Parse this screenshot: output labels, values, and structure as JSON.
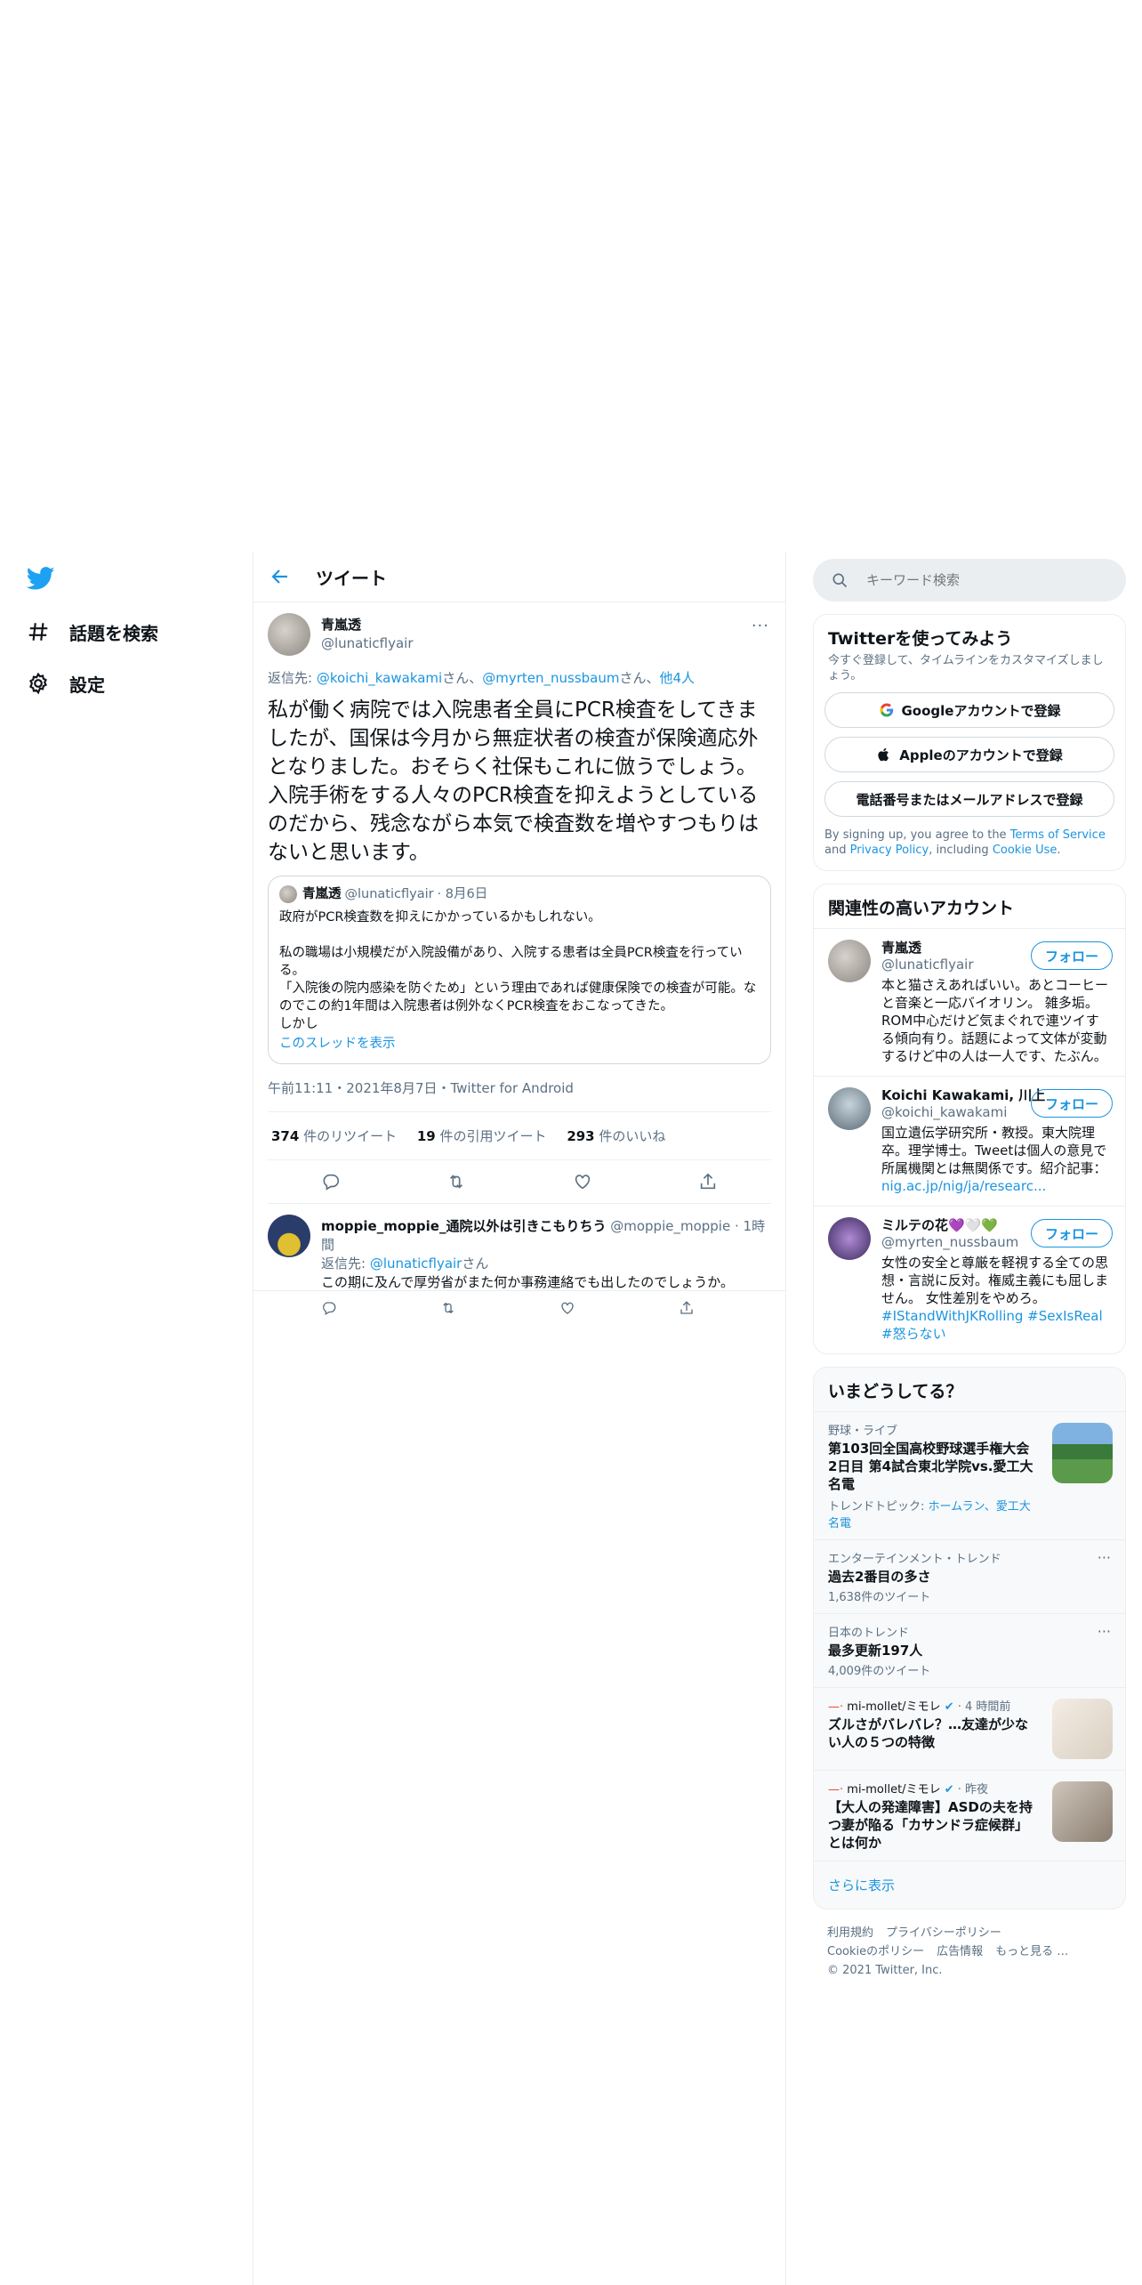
{
  "nav": {
    "items": [
      {
        "label": "話題を検索",
        "icon": "hashtag-icon"
      },
      {
        "label": "設定",
        "icon": "gear-icon"
      }
    ]
  },
  "header": {
    "title": "ツイート"
  },
  "tweet": {
    "name": "青嵐透",
    "handle": "@lunaticflyair",
    "reply_prefix": "返信先: ",
    "reply_1": "@koichi_kawakami",
    "reply_sep1": "さん、",
    "reply_2": "@myrten_nussbaum",
    "reply_sep2": "さん、",
    "reply_others": "他4人",
    "text": "私が働く病院では入院患者全員にPCR検査をしてきましたが、国保は今月から無症状者の検査が保険適応外となりました。おそらく社保もこれに倣うでしょう。\n入院手術をする人々のPCR検査を抑えようとしているのだから、残念ながら本気で検査数を増やすつもりはないと思います。",
    "quote": {
      "name": "青嵐透",
      "handle": "@lunaticflyair",
      "date": "· 8月6日",
      "text": "政府がPCR検査数を抑えにかかっているかもしれない。\n\n私の職場は小規模だが入院設備があり、入院する患者は全員PCR検査を行っている。\n「入院後の院内感染を防ぐため」という理由であれば健康保険での検査が可能。なのでこの約1年間は入院患者は例外なくPCR検査をおこなってきた。\nしかし",
      "show_thread": "このスレッドを表示"
    },
    "meta": "午前11:11・2021年8月7日・Twitter for Android",
    "stats": {
      "retweets": "374",
      "retweets_label": " 件のリツイート",
      "quotes": "19",
      "quotes_label": " 件の引用ツイート",
      "likes": "293",
      "likes_label": " 件のいいね"
    }
  },
  "reply": {
    "name": "moppie_moppie_通院以外は引きこもりちう",
    "handle": "@moppie_moppie",
    "time": "· 1時間",
    "reply_prefix": "返信先: ",
    "reply_to": "@lunaticflyair",
    "reply_suffix": "さん",
    "text": "この期に及んで厚労省がまた何か事務連絡でも出したのでしょうか。"
  },
  "search": {
    "placeholder": "キーワード検索"
  },
  "signup": {
    "title": "Twitterを使ってみよう",
    "sub": "今すぐ登録して、タイムラインをカスタマイズしましょう。",
    "google": "Googleアカウントで登録",
    "apple": "Appleのアカウントで登録",
    "phone": "電話番号またはメールアドレスで登録",
    "legal_1": "By signing up, you agree to the ",
    "terms": "Terms of Service",
    "legal_2": " and ",
    "privacy": "Privacy Policy",
    "legal_3": ", including ",
    "cookie": "Cookie Use",
    "legal_4": "."
  },
  "related": {
    "title": "関連性の高いアカウント",
    "follow": "フォロー",
    "accounts": [
      {
        "name": "青嵐透",
        "handle": "@lunaticflyair",
        "bio": "本と猫さえあればいい。あとコーヒーと音楽と一応バイオリン。 雑多垢。ROM中心だけど気まぐれで連ツイする傾向有り。話題によって文体が変動するけど中の人は一人です、たぶん。"
      },
      {
        "name": "Koichi Kawakami, 川上",
        "handle": "@koichi_kawakami",
        "bio": "国立遺伝学研究所・教授。東大院理卒。理学博士。Tweetは個人の意見で所属機関とは無関係です。紹介記事：",
        "link": "nig.ac.jp/nig/ja/researc..."
      },
      {
        "name": "ミルテの花💜🤍💚",
        "handle": "@myrten_nussbaum",
        "bio": "女性の安全と尊厳を軽視する全ての思想・言説に反対。権威主義にも屈しません。 女性差別をやめろ。",
        "tags": "#IStandWithJKRolling #SexIsReal #怒らない"
      }
    ]
  },
  "trends": {
    "title": "いまどうしてる？",
    "items": [
      {
        "ctx": "野球・ライブ",
        "title": "第103回全国高校野球選手権大会2日目 第4試合東北学院vs.愛工大名電",
        "extra_prefix": "トレンドトピック: ",
        "extra": "ホームラン、愛工大名電"
      },
      {
        "ctx": "エンターテインメント・トレンド",
        "title": "過去2番目の多さ",
        "count": "1,638件のツイート"
      },
      {
        "ctx": "日本のトレンド",
        "title": "最多更新197人",
        "count": "4,009件のツイート"
      },
      {
        "source": "mi-mollet/ミモレ",
        "time": "· 4 時間前",
        "title": "ズルさがバレバレ？…友達が少ない人の５つの特徴"
      },
      {
        "source": "mi-mollet/ミモレ",
        "time": "· 昨夜",
        "title": "【大人の発達障害】ASDの夫を持つ妻が陥る「カサンドラ症候群」とは何か"
      }
    ],
    "show_more": "さらに表示"
  },
  "footer": {
    "links": [
      "利用規約",
      "プライバシーポリシー",
      "Cookieのポリシー",
      "広告情報",
      "もっと見る …"
    ],
    "copyright": "© 2021 Twitter, Inc."
  },
  "colors": {
    "accent": "#1b95e0",
    "border": "#ebeef0",
    "muted": "#5b7083"
  }
}
